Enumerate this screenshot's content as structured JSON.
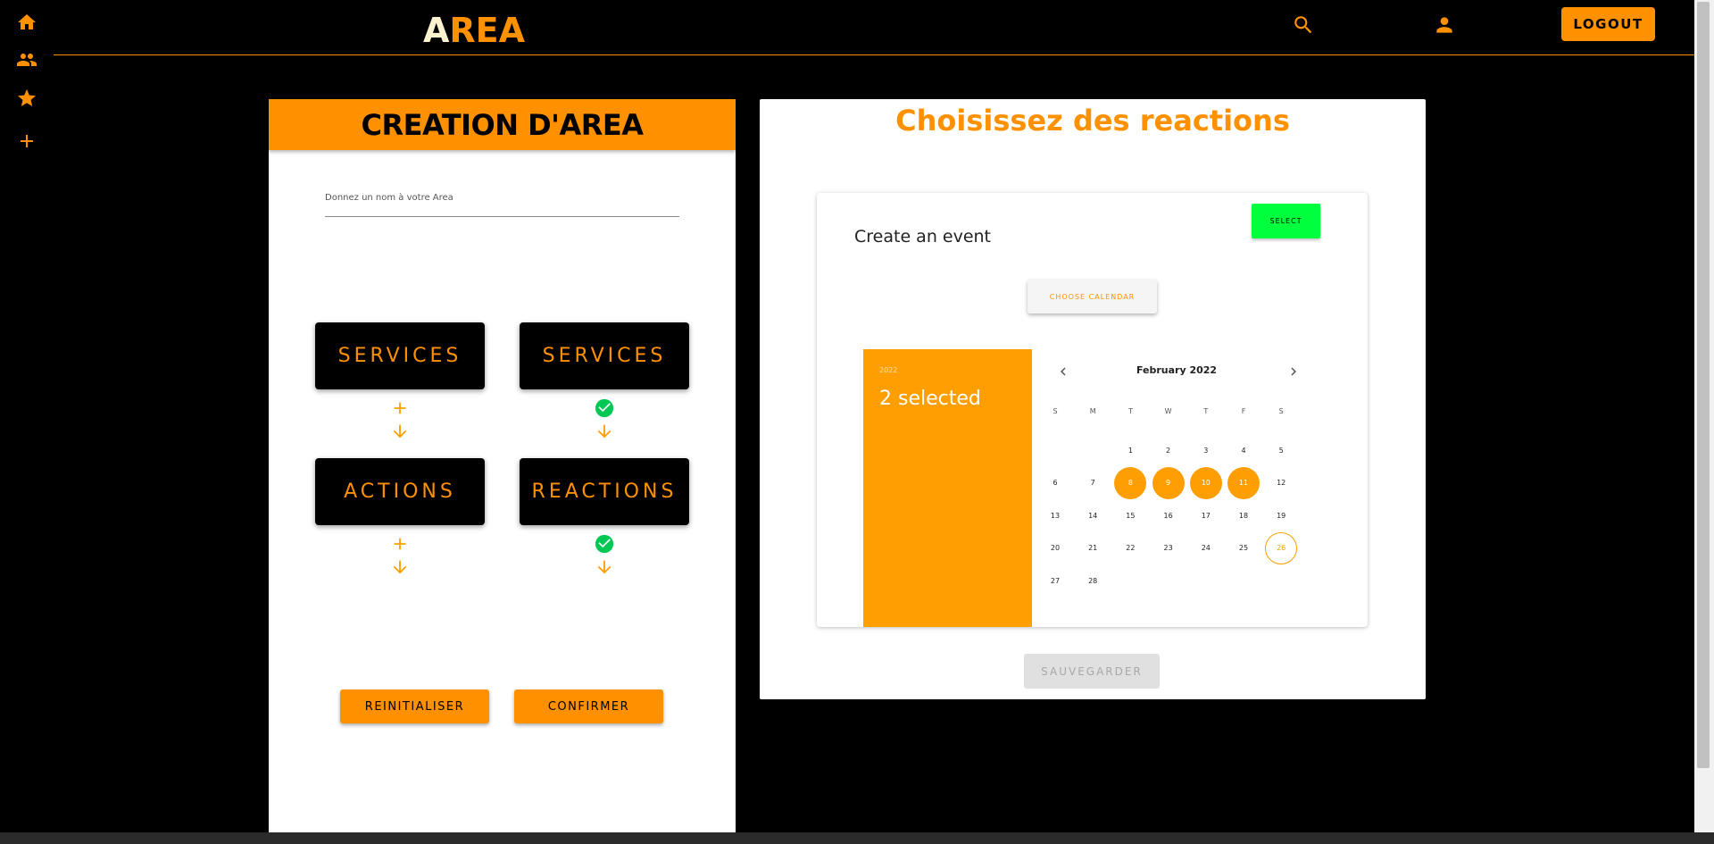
{
  "app": {
    "logo_first": "A",
    "logo_rest": "REA",
    "logout_label": "LOGOUT"
  },
  "sidebar": {
    "items": [
      {
        "icon": "home-icon"
      },
      {
        "icon": "people-icon"
      },
      {
        "icon": "star-icon"
      },
      {
        "icon": "plus-icon"
      }
    ]
  },
  "creation": {
    "header": "CREATION D'AREA",
    "name_placeholder": "Donnez un nom à votre Area",
    "blocks": {
      "services_left": "SERVICES",
      "services_right": "SERVICES",
      "actions": "ACTIONS",
      "reactions": "REACTIONS"
    },
    "reset_label": "REINITIALISER",
    "confirm_label": "CONFIRMER"
  },
  "reactions": {
    "title": "Choisissez des reactions",
    "event_title": "Create an event",
    "select_label": "SELECT",
    "choose_calendar_label": "CHOOSE CALENDAR",
    "save_label": "SAUVEGARDER"
  },
  "calendar": {
    "year": "2022",
    "selected_summary": "2 selected",
    "month_label": "February 2022",
    "weekdays": [
      "S",
      "M",
      "T",
      "W",
      "T",
      "F",
      "S"
    ],
    "first_weekday_index": 2,
    "days_in_month": 28,
    "selected_days": [
      8,
      9,
      10,
      11
    ],
    "today": 26
  },
  "colors": {
    "accent": "#ff9100",
    "calendar_accent": "#ff9e00",
    "select_green": "#00ff3c",
    "check_green": "#00c853"
  }
}
